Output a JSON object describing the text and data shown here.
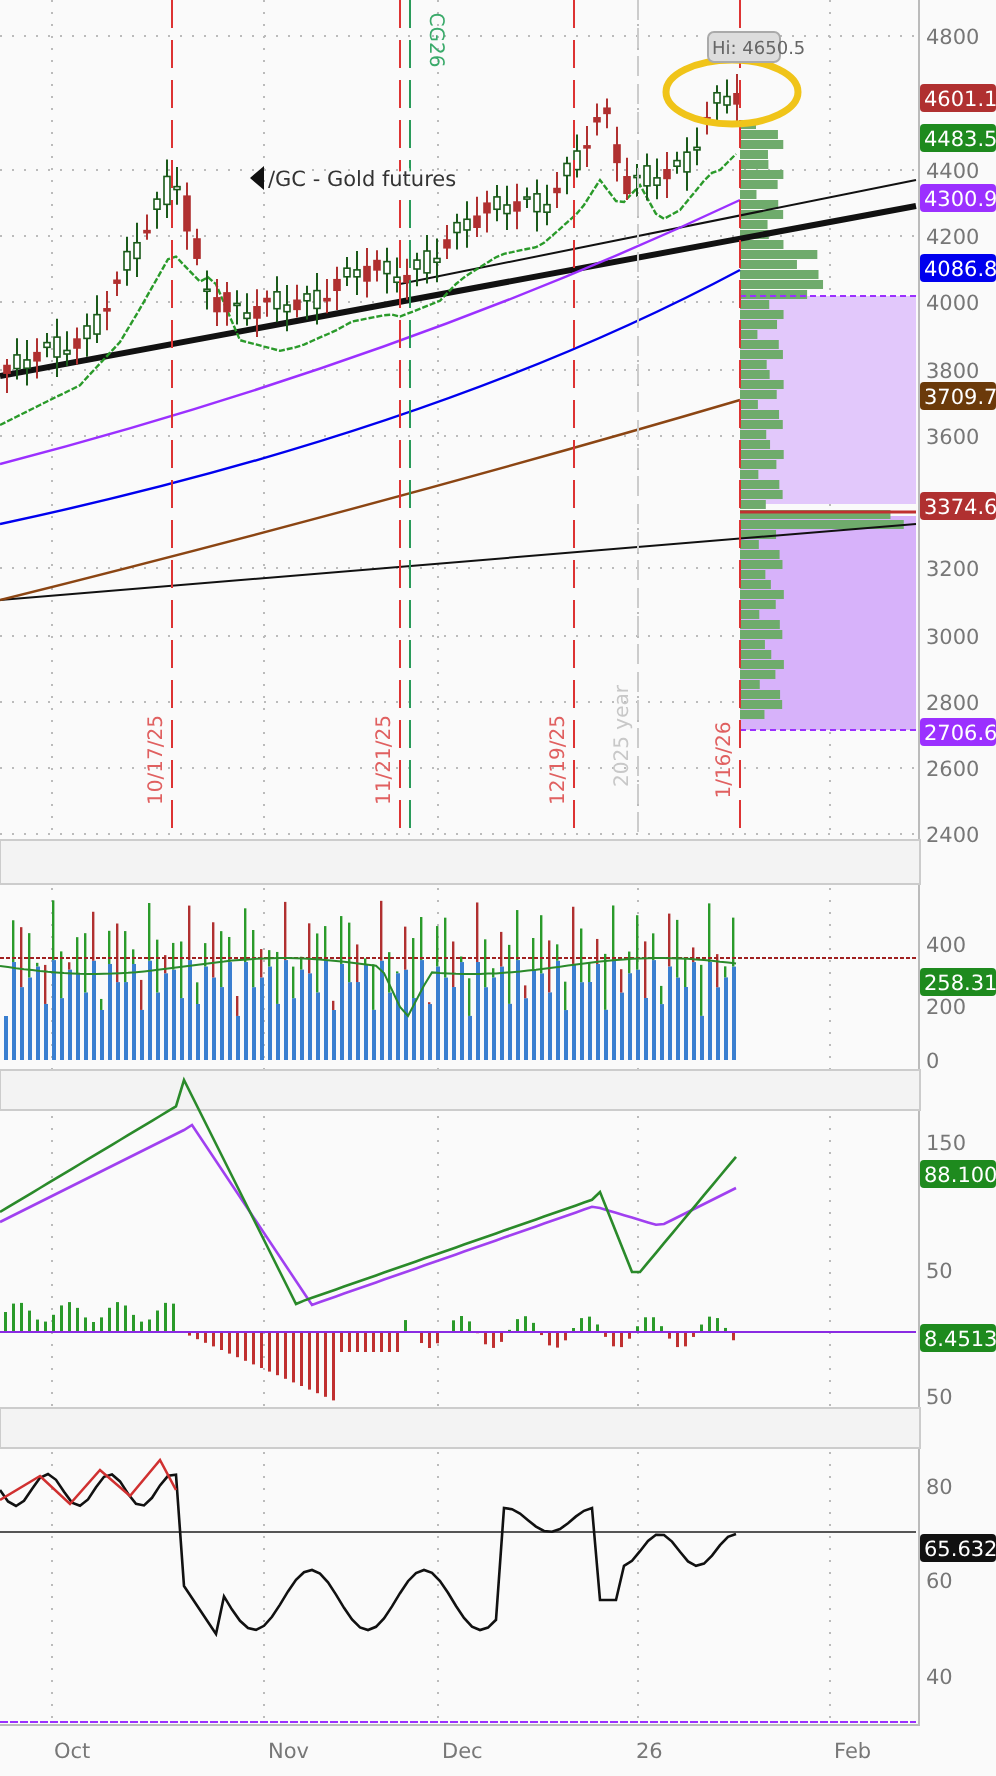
{
  "price_pane": {
    "symbol_label": "/GC - Gold futures",
    "contract_label": "CG26",
    "high_label": "Hi: 4650.5",
    "year_label": "2025 year",
    "y_ticks": [
      "4800",
      "4400",
      "4200",
      "4000",
      "3800",
      "3600",
      "3200",
      "3000",
      "2800",
      "2600",
      "2400"
    ],
    "price_tags": [
      {
        "text": "4601.1",
        "color": "#b03030"
      },
      {
        "text": "4483.5",
        "color": "#1e8a1e"
      },
      {
        "text": "4300.9",
        "color": "#9b30ff"
      },
      {
        "text": "4086.8",
        "color": "#0000ee"
      },
      {
        "text": "3709.7",
        "color": "#6b3a0a"
      },
      {
        "text": "3374.6",
        "color": "#b03030"
      },
      {
        "text": "2706.6",
        "color": "#9b30ff"
      }
    ],
    "event_lines": [
      "10/17/25",
      "11/21/25",
      "12/19/25",
      "1/16/26"
    ]
  },
  "volume_pane": {
    "y_ticks": [
      "400",
      "200",
      "0"
    ],
    "tag": {
      "text": "258.31",
      "color": "#1e8a1e"
    }
  },
  "macd_pane": {
    "y_ticks": [
      "150",
      "50",
      "50"
    ],
    "tags": [
      {
        "text": "88.100",
        "color": "#1e8a1e"
      },
      {
        "text": "8.4513",
        "color": "#1e8a1e"
      }
    ]
  },
  "rsi_pane": {
    "y_ticks": [
      "80",
      "60",
      "40"
    ],
    "tag": {
      "text": "65.632",
      "color": "#111111"
    }
  },
  "x_axis": [
    "Oct",
    "Nov",
    "Dec",
    "26",
    "Feb"
  ]
}
